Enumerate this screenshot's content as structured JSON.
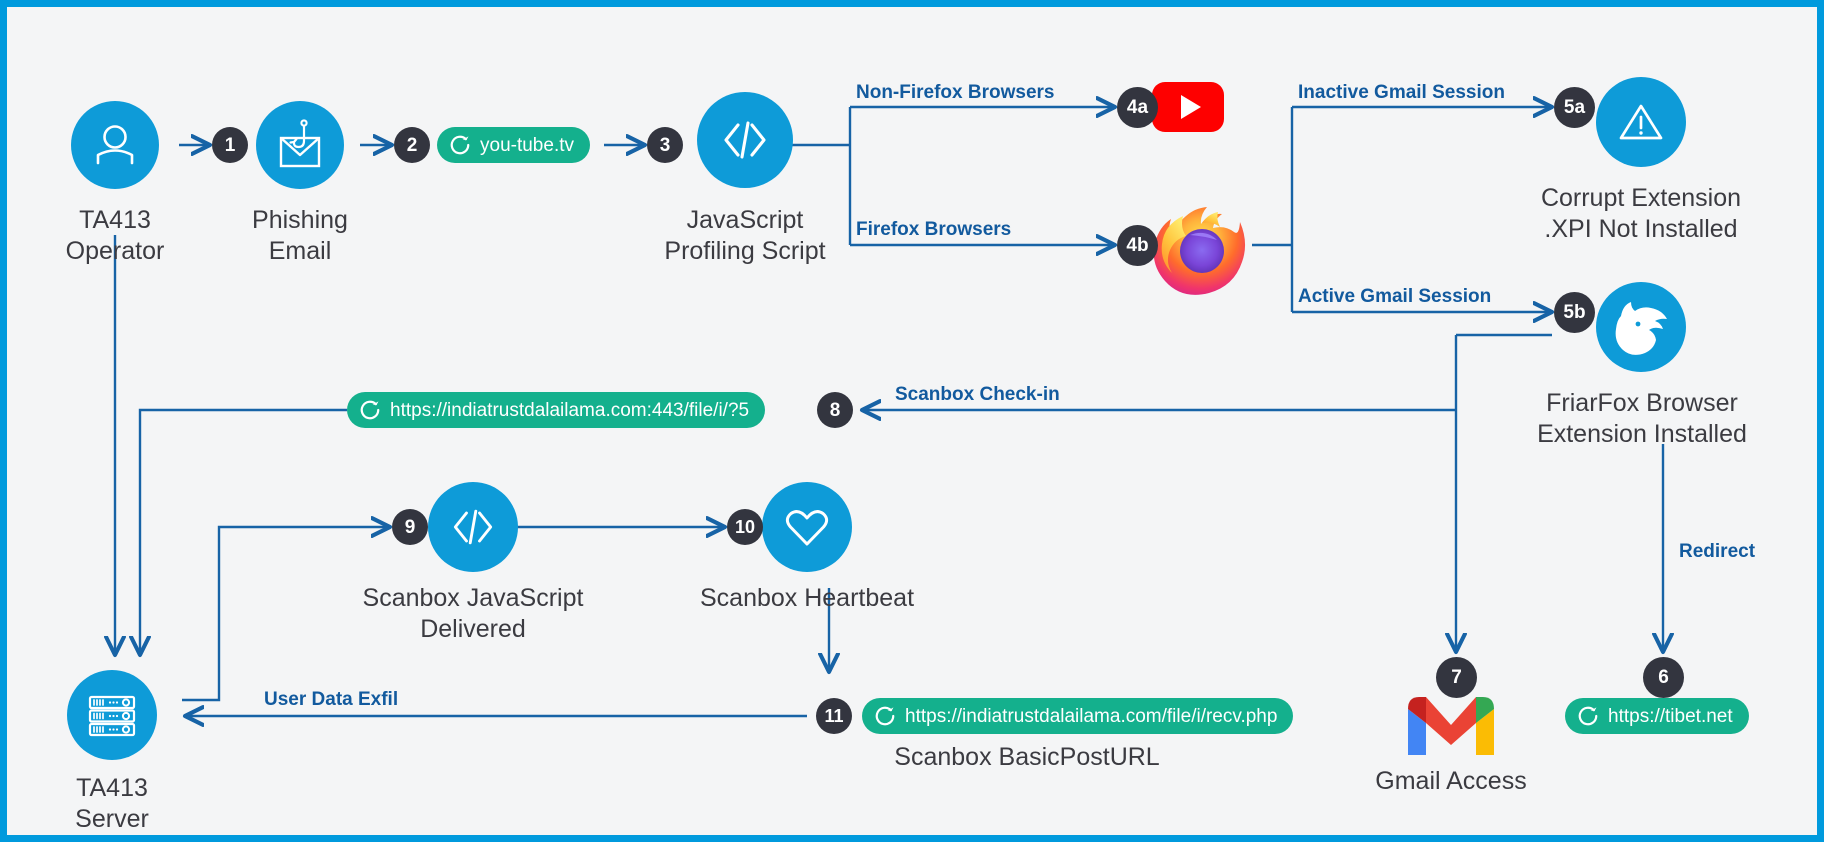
{
  "diagram": {
    "title": "TA413 Phishing to Scanbox and FriarFox Attack Chain",
    "background_color": "#f4f5f6",
    "border_color": "#009add",
    "node_color": "#0e9bd8",
    "badge_color": "#33353f",
    "pill_color": "#14b08d",
    "edge_color": "#125a9e",
    "caption_color": "#3b3b41"
  },
  "nodes": {
    "operator": {
      "badge": "",
      "caption": "TA413\nOperator",
      "icon": "user-icon"
    },
    "phishing_email": {
      "badge": "1",
      "caption": "Phishing\nEmail",
      "icon": "phishing-hook-envelope-icon"
    },
    "youtube_pill": {
      "badge": "2",
      "url": "you-tube.tv",
      "icon": "refresh-icon"
    },
    "profiling_script": {
      "badge": "3",
      "caption": "JavaScript\nProfiling Script",
      "icon": "code-brackets-icon"
    },
    "youtube_logo": {
      "badge": "4a",
      "caption": "",
      "icon": "youtube-icon"
    },
    "firefox_logo": {
      "badge": "4b",
      "caption": "",
      "icon": "firefox-icon"
    },
    "corrupt_extension": {
      "badge": "5a",
      "caption": "Corrupt Extension\n.XPI Not Installed",
      "icon": "warning-triangle-icon"
    },
    "friarfox": {
      "badge": "5b",
      "caption": "FriarFox Browser\nExtension Installed",
      "icon": "fox-head-icon"
    },
    "tibet_pill": {
      "badge": "6",
      "url": "https://tibet.net",
      "icon": "refresh-icon"
    },
    "gmail": {
      "badge": "7",
      "caption": "Gmail Access",
      "icon": "gmail-icon"
    },
    "checkin_pill": {
      "badge": "8",
      "url": "https://indiatrustdalailama.com:443/file/i/?5",
      "icon": "refresh-icon"
    },
    "scanbox_js": {
      "badge": "9",
      "caption": "Scanbox JavaScript\nDelivered",
      "icon": "code-brackets-icon"
    },
    "scanbox_heartbeat": {
      "badge": "10",
      "caption": "Scanbox Heartbeat",
      "icon": "heart-icon"
    },
    "basicposturl_pill": {
      "badge": "11",
      "url": "https://indiatrustdalailama.com/file/i/recv.php",
      "caption": "Scanbox BasicPostURL",
      "icon": "refresh-icon"
    },
    "ta413_server": {
      "badge": "",
      "caption": "TA413\nServer",
      "icon": "server-rack-icon"
    }
  },
  "edge_labels": {
    "non_firefox": "Non-Firefox Browsers",
    "firefox": "Firefox Browsers",
    "inactive_gmail": "Inactive Gmail Session",
    "active_gmail": "Active Gmail Session",
    "scanbox_checkin": "Scanbox Check-in",
    "redirect": "Redirect",
    "user_data_exfil": "User Data Exfil"
  }
}
